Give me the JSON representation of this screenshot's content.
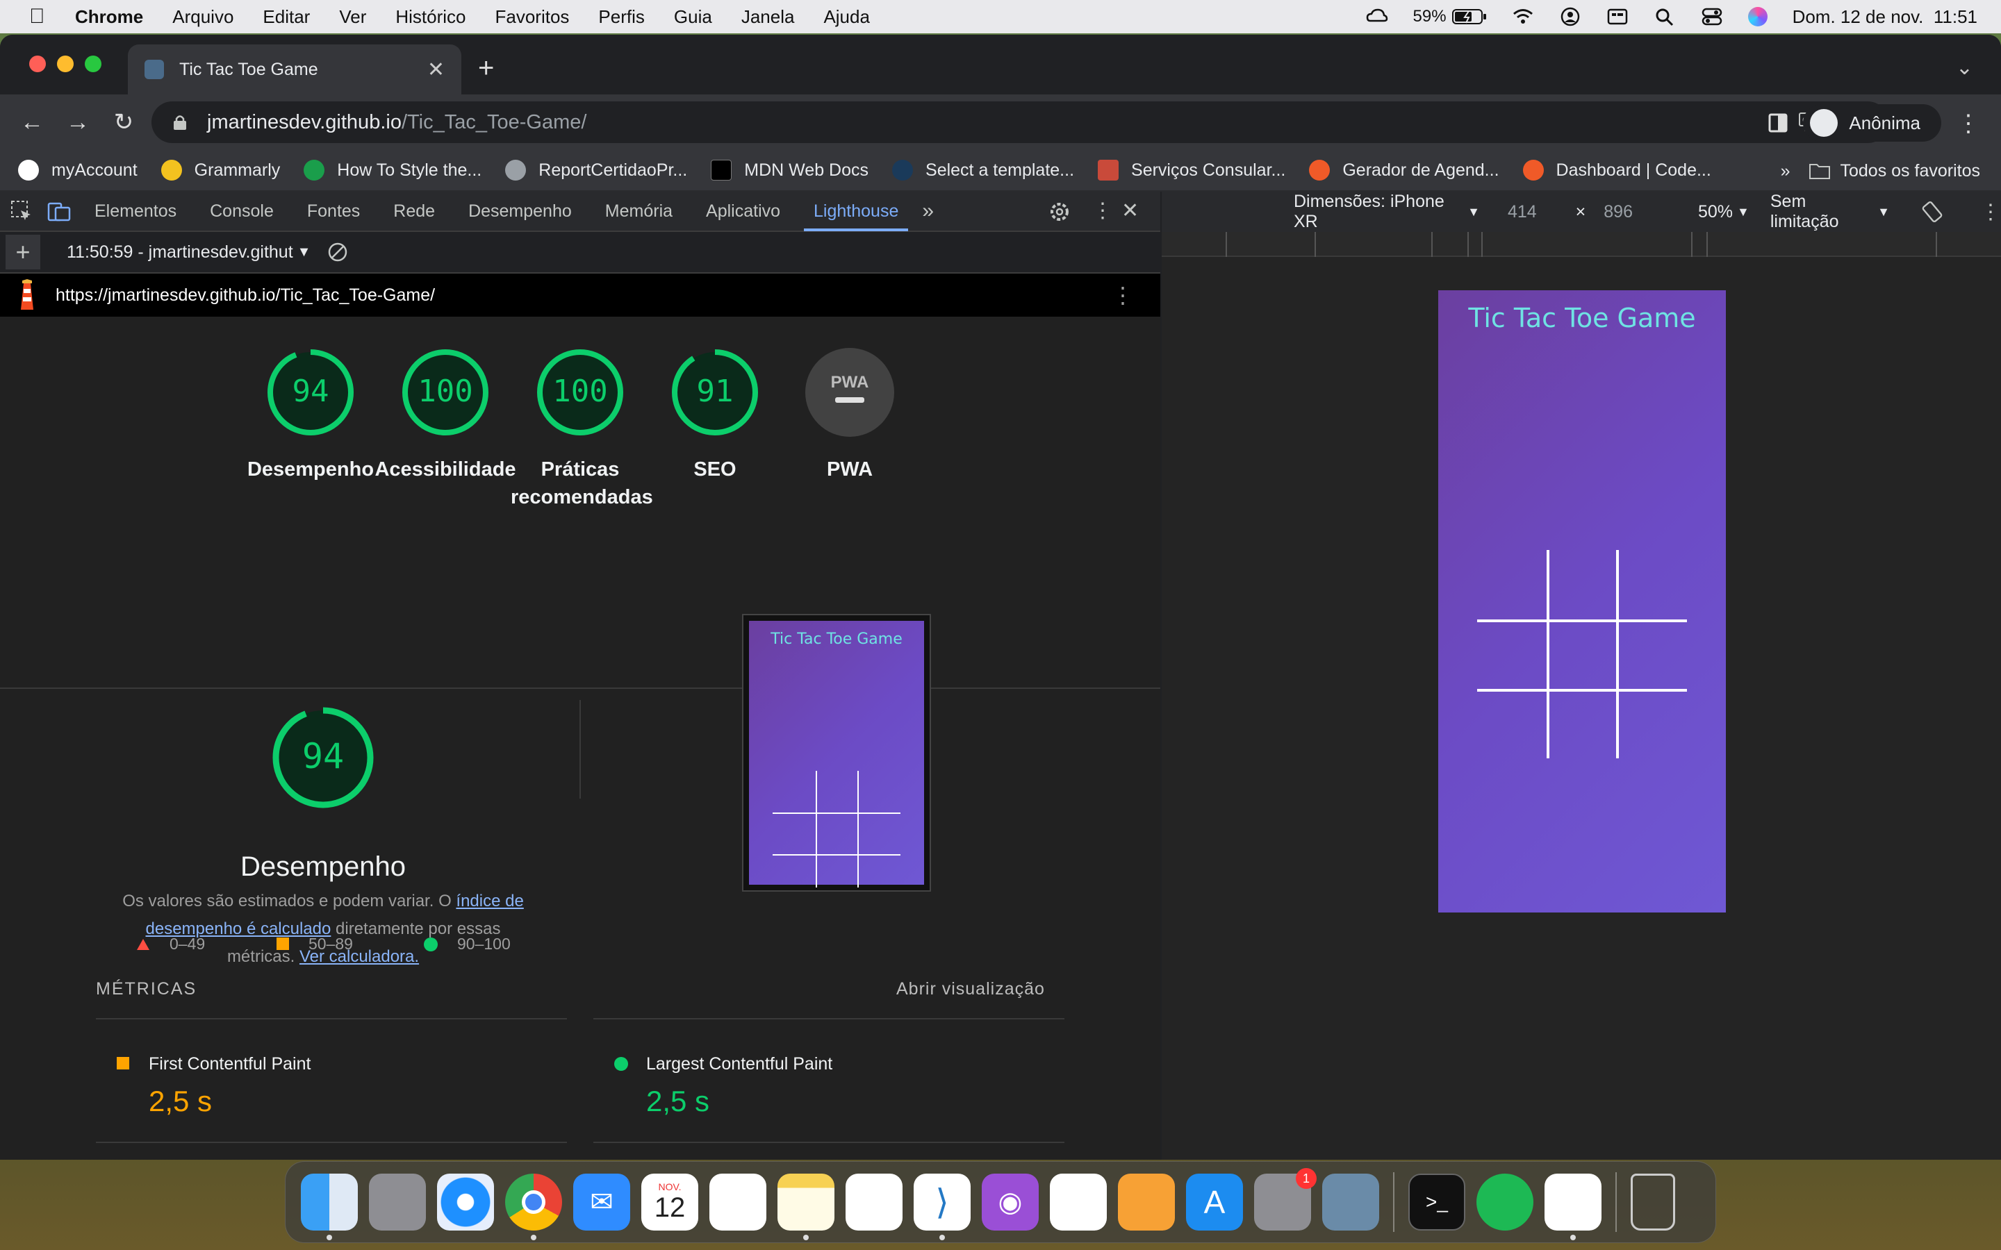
{
  "menubar": {
    "app": "Chrome",
    "items": [
      "Arquivo",
      "Editar",
      "Ver",
      "Histórico",
      "Favoritos",
      "Perfis",
      "Guia",
      "Janela",
      "Ajuda"
    ],
    "battery": "59%",
    "datetime": "Dom. 12 de nov.  11:51"
  },
  "browser": {
    "tab_title": "Tic Tac Toe Game",
    "url_host": "jmartinesdev.github.io",
    "url_path": "/Tic_Tac_Toe-Game/",
    "profile_label": "Anônima",
    "bookmarks": [
      {
        "label": "myAccount",
        "color": "#ffffff"
      },
      {
        "label": "Grammarly",
        "color": "#f3c21f"
      },
      {
        "label": "How To Style the...",
        "color": "#1a9e4b"
      },
      {
        "label": "ReportCertidaoPr...",
        "color": "#9aa0a6"
      },
      {
        "label": "MDN Web Docs",
        "color": "#000000"
      },
      {
        "label": "Select a template...",
        "color": "#1a3a5a"
      },
      {
        "label": "Serviços Consular...",
        "color": "#c94a3a"
      },
      {
        "label": "Gerador de Agend...",
        "color": "#f05a28"
      },
      {
        "label": "Dashboard | Code...",
        "color": "#f05a28"
      }
    ],
    "bookmarks_overflow": "»",
    "all_bookmarks": "Todos os favoritos"
  },
  "devtools": {
    "tabs": [
      "Elementos",
      "Console",
      "Fontes",
      "Rede",
      "Desempenho",
      "Memória",
      "Aplicativo",
      "Lighthouse"
    ],
    "selected_tab": "Lighthouse",
    "report_selector": "11:50:59 - jmartinesdev.githut",
    "report_url": "https://jmartinesdev.github.io/Tic_Tac_Toe-Game/"
  },
  "lighthouse": {
    "scores": [
      {
        "value": "94",
        "label": "Desempenho",
        "level": 0.94
      },
      {
        "value": "100",
        "label": "Acessibilidade",
        "level": 1.0
      },
      {
        "value": "100",
        "label": "Práticas recomendadas",
        "level": 1.0
      },
      {
        "value": "91",
        "label": "SEO",
        "level": 0.91
      }
    ],
    "pwa": {
      "badge": "PWA",
      "label": "PWA"
    },
    "perf_score": "94",
    "perf_level": 0.94,
    "perf_title": "Desempenho",
    "perf_desc_1": "Os valores são estimados e podem variar. O ",
    "perf_desc_link1": "índice de desempenho é calculado",
    "perf_desc_2": " diretamente por essas métricas. ",
    "perf_desc_link2": "Ver calculadora.",
    "legend": [
      "0–49",
      "50–89",
      "90–100"
    ],
    "metrics_heading": "MÉTRICAS",
    "open_view": "Abrir visualização",
    "metrics": [
      {
        "name": "First Contentful Paint",
        "value": "2,5 s",
        "status": "average",
        "color": "#ffa400"
      },
      {
        "name": "Largest Contentful Paint",
        "value": "2,5 s",
        "status": "pass",
        "color": "#0cce6b"
      }
    ],
    "colors": {
      "pass": "#0cce6b",
      "average": "#ffa400",
      "fail": "#ff4e42"
    }
  },
  "emulator": {
    "dimensions_label": "Dimensões: iPhone XR",
    "width": "414",
    "x": "×",
    "height": "896",
    "zoom": "50%",
    "throttle": "Sem limitação"
  },
  "game": {
    "title": "Tic Tac Toe Game"
  }
}
